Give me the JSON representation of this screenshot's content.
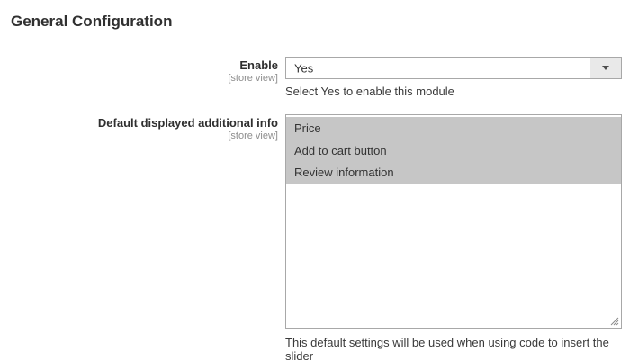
{
  "page": {
    "title": "General Configuration"
  },
  "colors": {
    "selected_option_bg": "#c6c6c6",
    "field_border": "#a8a8a8",
    "arrow_area_bg": "#e9e9e9",
    "title_text": "#303030",
    "scope_text": "#8e8e8e"
  },
  "icons": {
    "dropdown_arrow": "chevron-down-icon",
    "resize_handle": "resize-grip-icon"
  },
  "fields": [
    {
      "label": "Enable",
      "scope": "[store view]",
      "value": "Yes",
      "note": "Select Yes to enable this module"
    },
    {
      "label": "Default displayed additional info",
      "scope": "[store view]",
      "options": [
        "Price",
        "Add to cart button",
        "Review information"
      ],
      "note": "This default settings will be used when using code to insert the slider"
    }
  ]
}
